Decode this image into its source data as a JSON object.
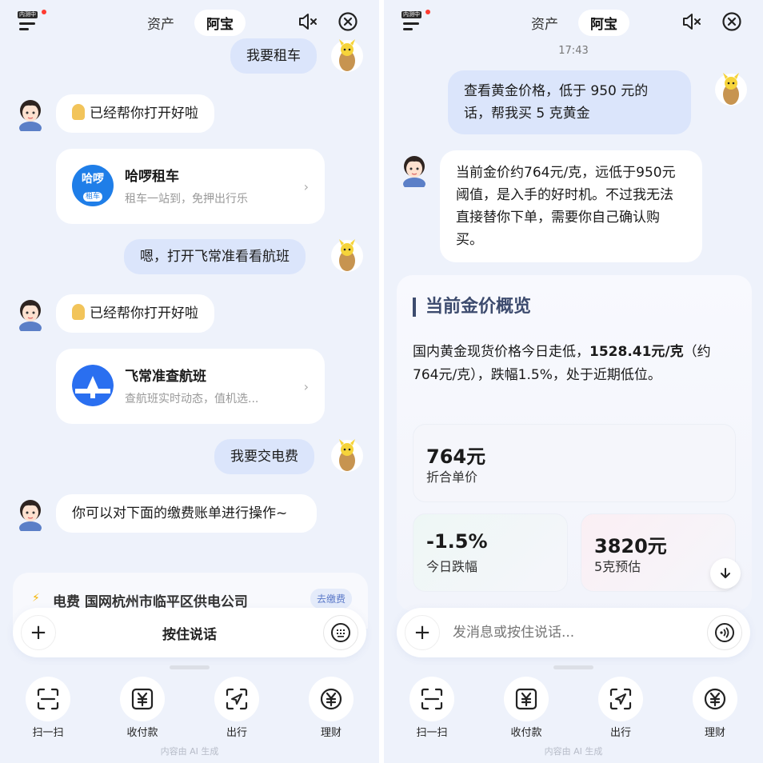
{
  "header": {
    "badge": "内测中",
    "tabs": [
      "资产",
      "阿宝"
    ]
  },
  "left": {
    "messages": {
      "user1": "我要租车",
      "ai1": "已经帮你打开好啦",
      "app1_name": "哈啰租车",
      "app1_desc": "租车一站到，免押出行乐",
      "app1_logo_top": "哈啰",
      "app1_logo_bottom": "租车",
      "user2": "嗯，打开飞常准看看航班",
      "ai2": "已经帮你打开好啦",
      "app2_name": "飞常准查航班",
      "app2_desc": "查航班实时动态，值机选...",
      "user3": "我要交电费",
      "ai3": "你可以对下面的缴费账单进行操作~",
      "bill_title": "电费 国网杭州市临平区供电公司",
      "bill_action": "去缴费"
    },
    "input_label": "按住说话"
  },
  "right": {
    "time": "17:43",
    "user_msg": "查看黄金价格，低于 950 元的话，帮我买 5 克黄金",
    "ai_msg": "当前金价约764元/克，远低于950元阈值，是入手的好时机。不过我无法直接替你下单，需要你自己确认购买。",
    "card": {
      "title": "当前金价概览",
      "body_pre": "国内黄金现货价格今日走低，",
      "body_bold": "1528.41元/克",
      "body_post": "（约764元/克），跌幅1.5%，处于近期低位。",
      "stat1_value": "764元",
      "stat1_label": "折合单价",
      "stat2_value": "-1.5%",
      "stat2_label": "今日跌幅",
      "stat3_value": "3820元",
      "stat3_label": "5克预估"
    },
    "input_placeholder": "发消息或按住说话..."
  },
  "nav": {
    "items": [
      "扫一扫",
      "收付款",
      "出行",
      "理财"
    ]
  },
  "footer": "内容由 AI 生成",
  "colors": {
    "background": "#eef2fb",
    "user_bubble": "#dbe5fb",
    "accent_blue": "#2a6ff0",
    "title_navy": "#3d4b6e"
  }
}
